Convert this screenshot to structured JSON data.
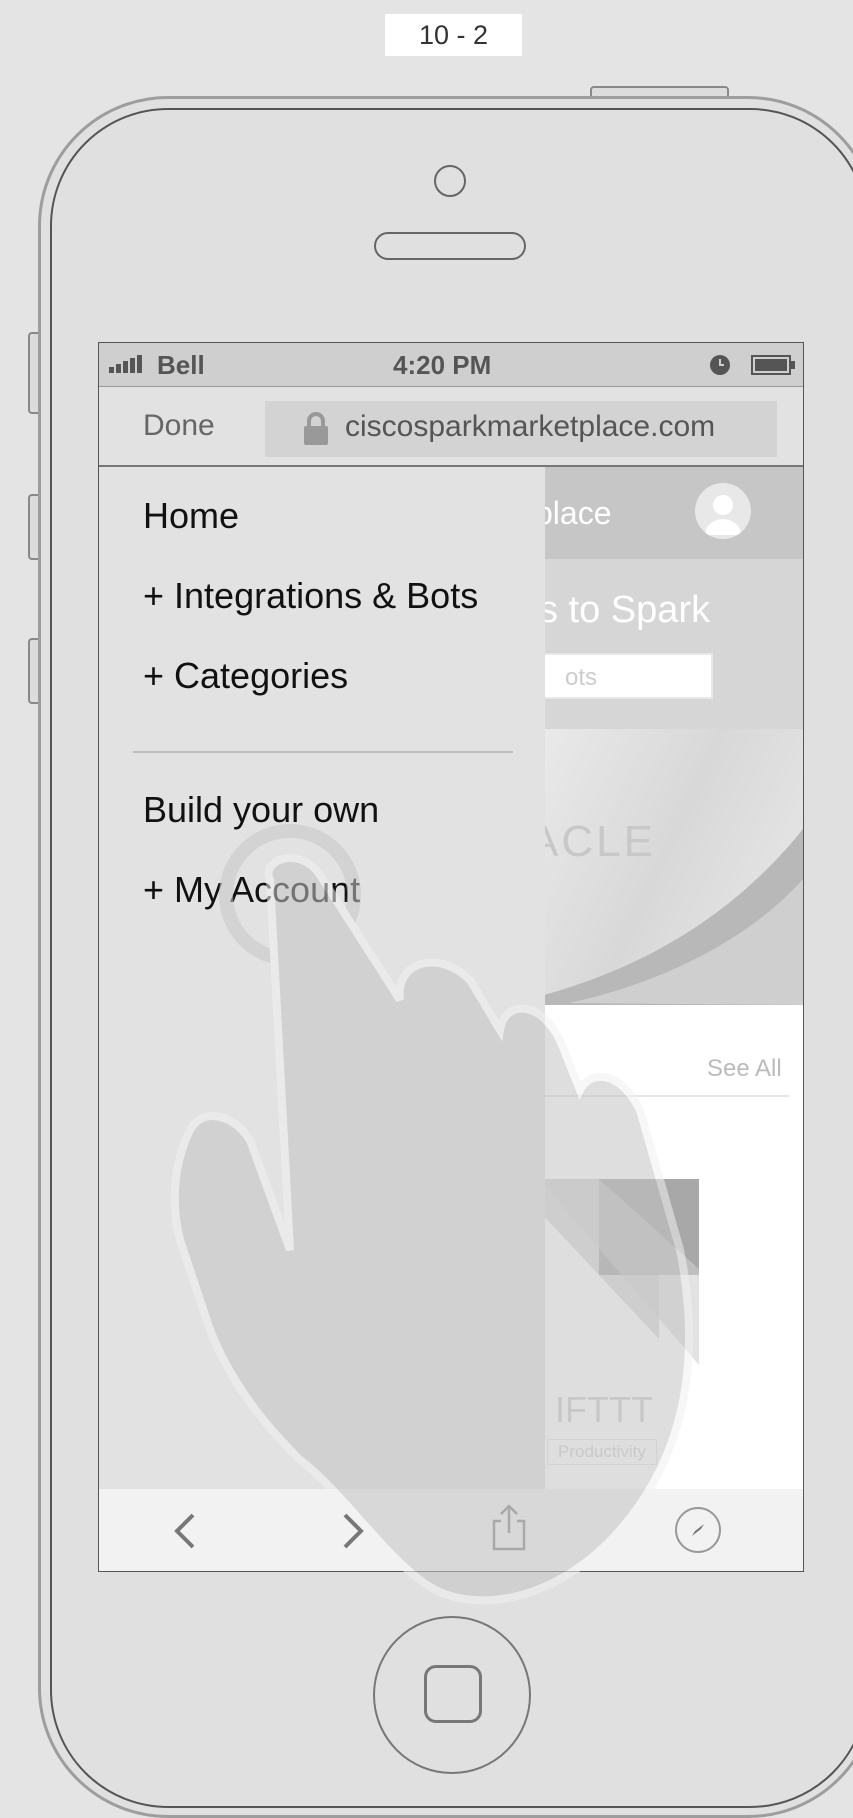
{
  "page_label": "10 - 2",
  "status_bar": {
    "carrier": "Bell",
    "time": "4:20 PM"
  },
  "browser": {
    "done_label": "Done",
    "url": "ciscosparkmarketplace.com"
  },
  "background_page": {
    "header_title_fragment": "place",
    "hero_text_fragment": "s to Spark",
    "search_placeholder_fragment": "ots",
    "banner_logo_fragment": "ACLE",
    "section_link": "See All",
    "card_title": "IFTTT",
    "card_tag": "Productivity"
  },
  "menu": {
    "items": [
      {
        "label": "Home"
      },
      {
        "label": "+ Integrations & Bots"
      },
      {
        "label": "+ Categories"
      },
      {
        "label": "Build your own"
      },
      {
        "label": "+ My Account"
      }
    ]
  },
  "icons": [
    "signal-icon",
    "lock-icon",
    "clock-icon",
    "battery-icon",
    "avatar-icon",
    "back-icon",
    "forward-icon",
    "share-icon",
    "compass-icon",
    "hand-gesture-icon"
  ]
}
